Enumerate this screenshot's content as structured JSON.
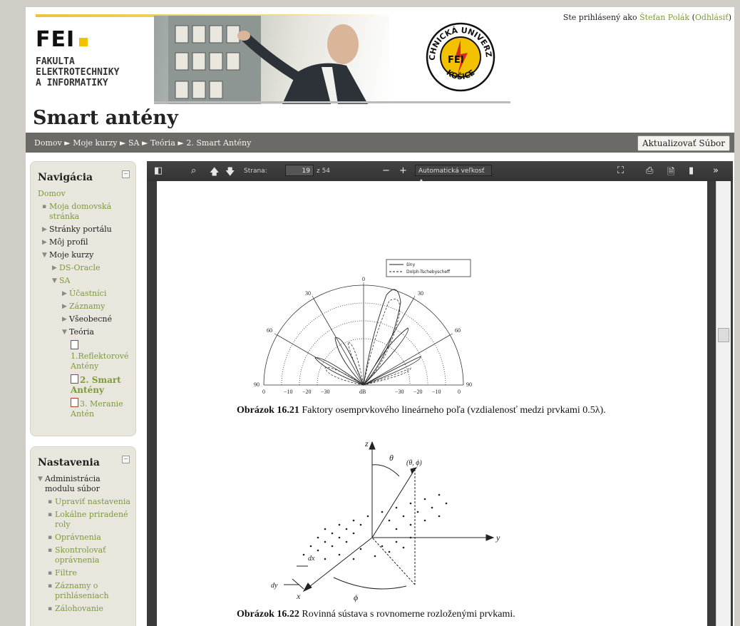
{
  "header": {
    "logo_big": "FEI",
    "logo_lines": [
      "FAKULTA",
      "ELEKTROTECHNIKY",
      "A INFORMATIKY"
    ],
    "seal_top": "TECHNICKÁ UNIVERZITA",
    "seal_bottom": "KOŠICE",
    "seal_center": "FEI",
    "login_prefix": "Ste prihlásený ako",
    "login_user": "Štefan Polák",
    "login_logout": "Odhlásiť",
    "course_title": "Smart antény"
  },
  "breadcrumb": {
    "items": [
      "Domov",
      "Moje kurzy",
      "SA",
      "Teória",
      "2. Smart Antény"
    ],
    "separator": "►",
    "update_button": "Aktualizovať Súbor"
  },
  "navigation": {
    "title": "Navigácia",
    "items": [
      {
        "label": "Domov",
        "style": "green"
      },
      {
        "label": "Moja domovská stránka",
        "style": "green-bullet"
      },
      {
        "label": "Stránky portálu",
        "style": "dark-arrow"
      },
      {
        "label": "Môj profil",
        "style": "dark-arrow"
      },
      {
        "label": "Moje kurzy",
        "style": "dark-open"
      },
      {
        "label": "DS-Oracle",
        "style": "green-arrow"
      },
      {
        "label": "SA",
        "style": "green-open"
      },
      {
        "label": "Účastníci",
        "style": "green-arrow"
      },
      {
        "label": "Záznamy",
        "style": "green-arrow"
      },
      {
        "label": "Všeobecné",
        "style": "dark-arrow"
      },
      {
        "label": "Teória",
        "style": "dark-open"
      },
      {
        "label": "1.Reflektorové Antény",
        "style": "green-pdf"
      },
      {
        "label": "2. Smart Antény",
        "style": "green-pdf-bold"
      },
      {
        "label": "3. Meranie Antén",
        "style": "green-pdf"
      }
    ]
  },
  "settings": {
    "title": "Nastavenia",
    "section": "Administrácia modulu súbor",
    "items": [
      "Upraviť nastavenia",
      "Lokálne priradené roly",
      "Oprávnenia",
      "Skontrolovať oprávnenia",
      "Filtre",
      "Záznamy o prihláseniach",
      "Zálohovanie"
    ]
  },
  "viewer": {
    "page_label": "Strana:",
    "page_number": "19",
    "page_total": "z 54",
    "zoom": "Automatická veľkosť",
    "icons": [
      "sidebar-toggle-icon",
      "search-icon",
      "previous-page-icon",
      "next-page-icon",
      "zoom-out-icon",
      "zoom-in-icon",
      "fullscreen-icon",
      "print-icon",
      "download-icon",
      "bookmark-icon",
      "more-tools-icon"
    ]
  },
  "document": {
    "polar": {
      "legend": [
        "šíny",
        "Dolph-Tschebyscheff"
      ],
      "angle_labels": [
        "0",
        "30",
        "30",
        "60",
        "60",
        "90",
        "90"
      ],
      "db_labels": [
        "0",
        "−10",
        "−20",
        "−30",
        "dB",
        "−30",
        "−20",
        "−10",
        "0"
      ]
    },
    "caption1_bold": "Obrázok 16.21",
    "caption1_text": " Faktory osemprvkového lineárneho poľa (vzdialenosť medzi prvkami 0.5λ).",
    "diagram2_labels": [
      "z",
      "θ",
      "(θ, ϕ)",
      "y",
      "x",
      "ϕ",
      "dx",
      "dy"
    ],
    "caption2_bold": "Obrázok 16.22",
    "caption2_text": " Rovinná sústava s rovnomerne rozloženými prvkami."
  }
}
